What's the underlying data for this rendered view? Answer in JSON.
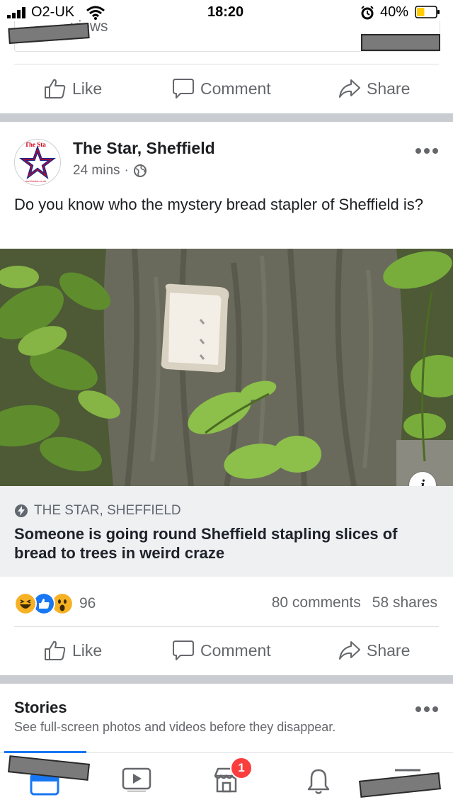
{
  "status_bar": {
    "carrier": "O2-UK",
    "time": "18:20",
    "battery_percent": "40%",
    "battery_level": 0.4,
    "icons": [
      "signal-icon",
      "wifi-icon",
      "alarm-icon",
      "battery-icon"
    ]
  },
  "prior_post": {
    "views_text": "views",
    "actions": {
      "like": "Like",
      "comment": "Comment",
      "share": "Share"
    }
  },
  "post": {
    "page_name": "The Star, Sheffield",
    "avatar_text": "The Sta",
    "avatar_url_text": "www.thestar.co.uk",
    "time": "24 mins",
    "separator": "·",
    "privacy_icon": "globe-icon",
    "text": "Do you know who the mystery bread stapler of Sheffield is?",
    "link": {
      "domain": "THE STAR, SHEFFIELD",
      "title": "Someone is going round Sheffield stapling slices of bread to trees in weird craze",
      "info_icon": "info-icon",
      "bolt_icon": "lightning-icon"
    },
    "reactions": {
      "types": [
        "haha",
        "like",
        "wow"
      ],
      "count": "96"
    },
    "comments": "80 comments",
    "shares": "58 shares",
    "actions": {
      "like": "Like",
      "comment": "Comment",
      "share": "Share"
    }
  },
  "stories": {
    "title": "Stories",
    "subtitle": "See full-screen photos and videos before they disappear."
  },
  "tabbar": {
    "items": [
      "news-feed",
      "watch",
      "marketplace",
      "notifications",
      "menu"
    ],
    "marketplace_badge": "1"
  },
  "colors": {
    "facebook_blue": "#1877f2",
    "text_primary": "#1c1e21",
    "text_secondary": "#65676b",
    "badge_red": "#fa3e3e",
    "separator_gray": "#c9ccd1"
  }
}
